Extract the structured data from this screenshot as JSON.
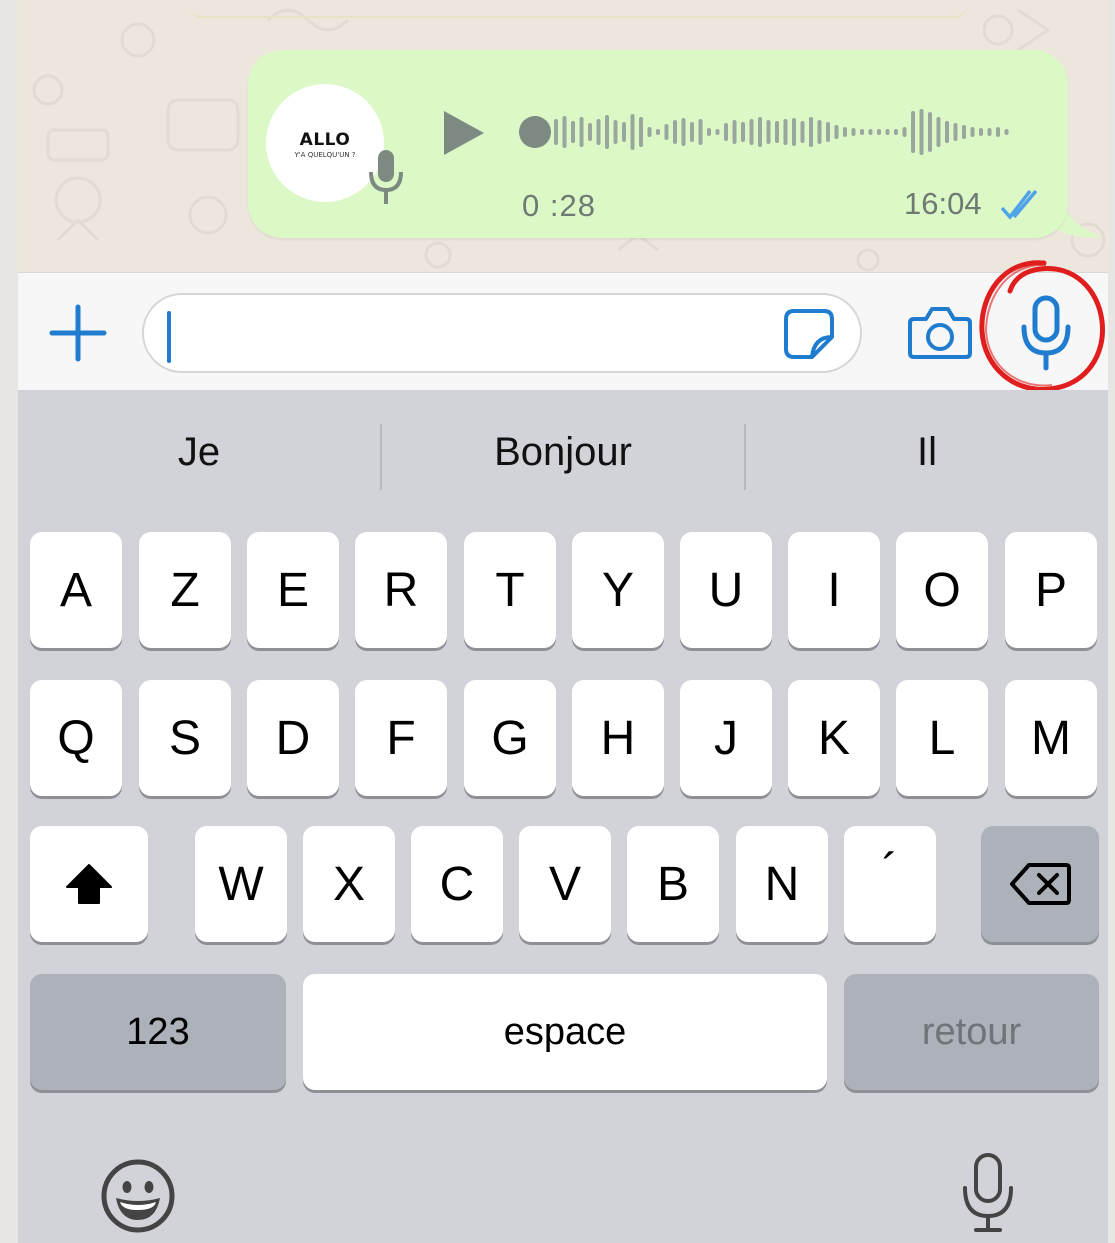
{
  "voice_message": {
    "avatar_title": "ALLO",
    "avatar_subtitle": "Y'A QUELQU'UN ?",
    "duration": "0 :28",
    "time": "16:04"
  },
  "input_bar": {
    "placeholder": ""
  },
  "suggestions": [
    "Je",
    "Bonjour",
    "Il"
  ],
  "keyboard": {
    "row1": [
      "A",
      "Z",
      "E",
      "R",
      "T",
      "Y",
      "U",
      "I",
      "O",
      "P"
    ],
    "row2": [
      "Q",
      "S",
      "D",
      "F",
      "G",
      "H",
      "J",
      "K",
      "L",
      "M"
    ],
    "row3": [
      "W",
      "X",
      "C",
      "V",
      "B",
      "N",
      "´"
    ],
    "numbers_label": "123",
    "space_label": "espace",
    "return_label": "retour"
  },
  "colors": {
    "accent_blue": "#1f7ccf",
    "bubble_green": "#dcf8c6",
    "highlight_red": "#e01e1e"
  },
  "icons": [
    "plus-icon",
    "sticker-icon",
    "camera-icon",
    "microphone-icon",
    "play-icon",
    "shift-icon",
    "delete-icon",
    "emoji-icon",
    "dictation-icon",
    "read-receipt-icon"
  ]
}
